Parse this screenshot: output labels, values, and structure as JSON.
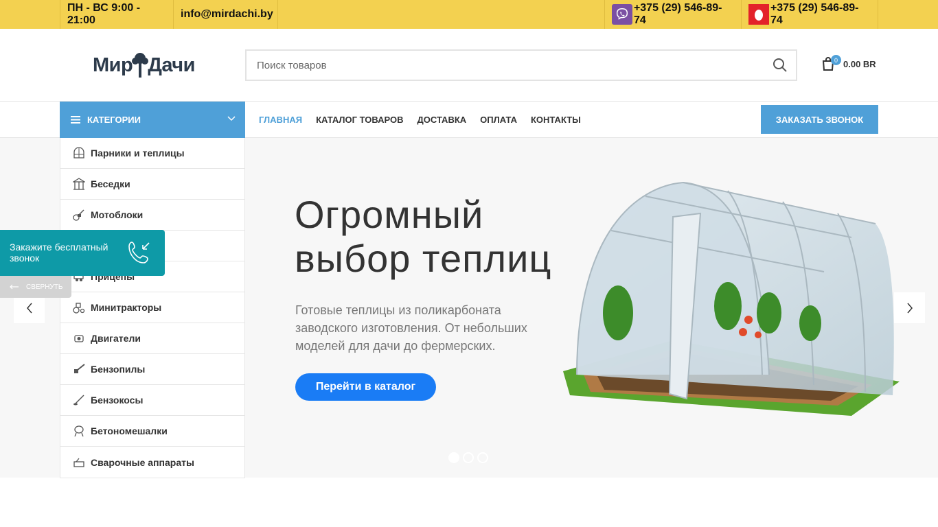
{
  "topbar": {
    "hours": "ПН - ВС 9:00 - 21:00",
    "email": "info@mirdachi.by",
    "phone_viber": "+375 (29) 546-89-74",
    "phone_mts": "+375 (29) 546-89-74"
  },
  "header": {
    "logo_part1": "Мир",
    "logo_part2": "Дачи",
    "search_placeholder": "Поиск товаров",
    "cart_count": "0",
    "cart_amount": "0.00 BR"
  },
  "nav": {
    "categories_label": "Категории",
    "menu": [
      "Главная",
      "Каталог товаров",
      "Доставка",
      "Оплата",
      "Контакты"
    ],
    "call_button": "Заказать звонок"
  },
  "categories": [
    "Парники и теплицы",
    "Беседки",
    "Мотоблоки",
    "",
    "Прицепы",
    "Минитракторы",
    "Двигатели",
    "Бензопилы",
    "Бензокосы",
    "Бетономешалки",
    "Сварочные аппараты"
  ],
  "slide": {
    "title_line1": "Огромный",
    "title_line2": "выбор теплиц",
    "text": "Готовые теплицы из поликарбоната заводского изготовления. От небольших моделей для дачи до фермерских.",
    "button": "Перейти в каталог",
    "active_dot": 1,
    "dot_count": 3
  },
  "callback_widget": {
    "text": "Закажите бесплатный звонок",
    "collapse": "Свернуть"
  },
  "colors": {
    "topbar": "#f3d150",
    "accent": "#4fa0d8",
    "slide_button": "#1a7cf5",
    "widget": "#0e9aa7"
  }
}
